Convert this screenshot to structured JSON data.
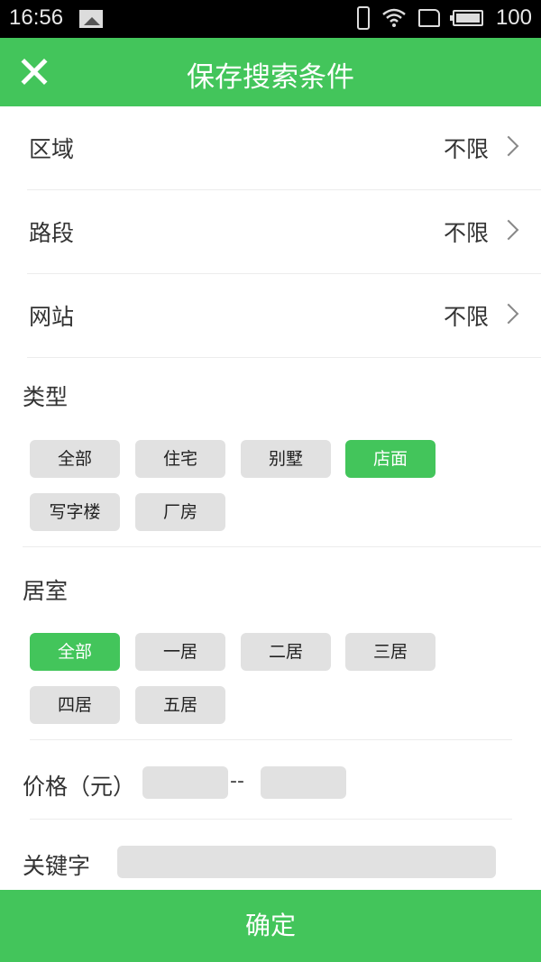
{
  "status_bar": {
    "time": "16:56",
    "battery_level": "100",
    "icons": [
      "image-icon",
      "vibrate-icon",
      "wifi-icon",
      "sim-icon",
      "battery-icon"
    ]
  },
  "app_bar": {
    "title": "保存搜索条件",
    "close_icon": "close-icon"
  },
  "rows": [
    {
      "label": "区域",
      "value": "不限"
    },
    {
      "label": "路段",
      "value": "不限"
    },
    {
      "label": "网站",
      "value": "不限"
    }
  ],
  "type_section": {
    "title": "类型",
    "options": [
      "全部",
      "住宅",
      "别墅",
      "店面",
      "写字楼",
      "厂房"
    ],
    "selected": "店面"
  },
  "room_section": {
    "title": "居室",
    "options": [
      "全部",
      "一居",
      "二居",
      "三居",
      "四居",
      "五居"
    ],
    "selected": "全部"
  },
  "price": {
    "label": "价格（元）",
    "separator": "--",
    "min_value": "",
    "max_value": ""
  },
  "keyword": {
    "label": "关键字",
    "value": ""
  },
  "confirm_label": "确定",
  "colors": {
    "accent": "#43c55b",
    "chip_bg": "#e1e1e1"
  }
}
